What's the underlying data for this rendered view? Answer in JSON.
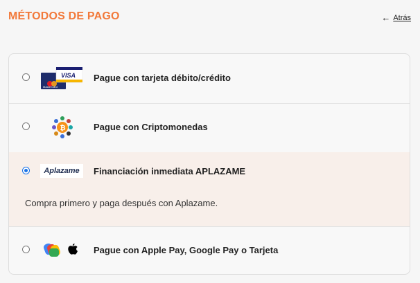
{
  "header": {
    "title": "MÉTODOS DE PAGO",
    "back_label": "Atrás"
  },
  "options": [
    {
      "label": "Pague con tarjeta débito/crédito",
      "selected": false,
      "logo_text_1": "VISA",
      "logo_text_2": "MasterCard"
    },
    {
      "label": "Pague con Criptomonedas",
      "selected": false
    },
    {
      "label": "Financiación inmediata APLAZAME",
      "selected": true,
      "logo_text": "Aplazame",
      "description": "Compra primero y paga después con Aplazame."
    },
    {
      "label": "Pague con Apple Pay, Google Pay o Tarjeta",
      "selected": false
    }
  ],
  "colors": {
    "accent": "#f2793a",
    "selected_bg": "#f8efea",
    "radio_checked": "#1a73e8"
  }
}
